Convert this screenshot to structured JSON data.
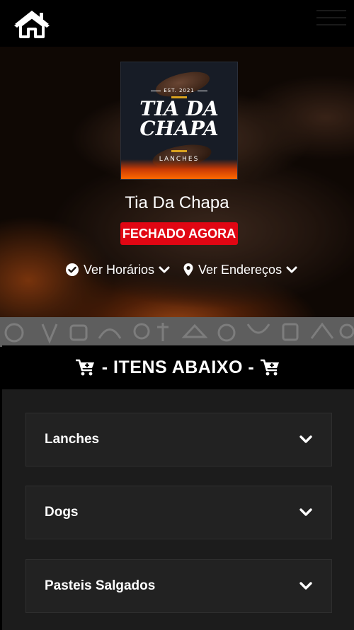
{
  "header": {
    "home_icon": "home-icon",
    "menu_icon": "hamburger-menu-icon"
  },
  "hero": {
    "logo": {
      "est": "EST. 2021",
      "brand_line1": "TIA DA",
      "brand_line2": "CHAPA",
      "sub": "LANCHES"
    },
    "store_name": "Tia Da Chapa",
    "status": "FECHADO AGORA",
    "status_color": "#e10613",
    "hours_link": "Ver Horários",
    "address_link": "Ver Endereços"
  },
  "items_section": {
    "title": "- ITENS ABAIXO -",
    "icon": "cart-plus-icon"
  },
  "categories": [
    {
      "label": "Lanches"
    },
    {
      "label": "Dogs"
    },
    {
      "label": "Pasteis Salgados"
    }
  ]
}
